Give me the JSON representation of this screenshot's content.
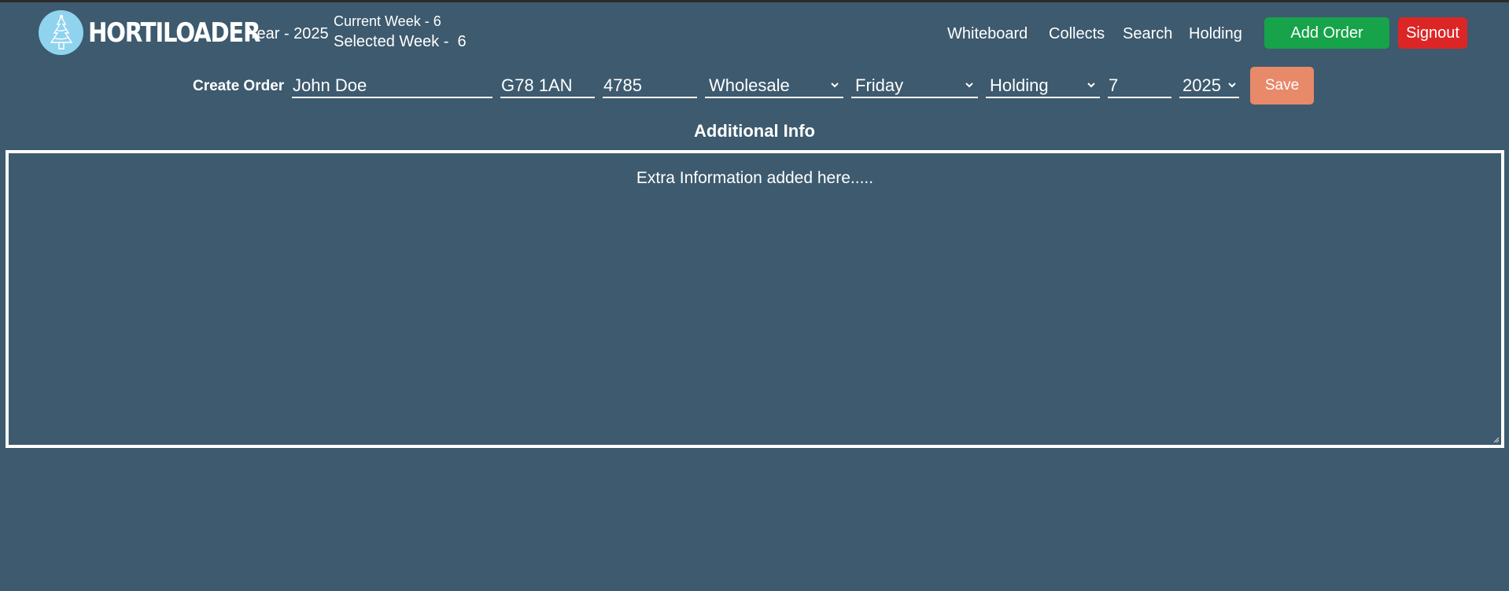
{
  "header": {
    "logo_text": "HORTILOADER",
    "year_text": "Year - 2025",
    "current_week": "Current Week - 6",
    "selected_week": "Selected Week -  6",
    "nav": {
      "whiteboard": "Whiteboard",
      "collects": "Collects",
      "search": "Search",
      "holding": "Holding"
    },
    "add_order_label": "Add Order",
    "signout_label": "Signout"
  },
  "form": {
    "label": "Create Order",
    "customer_name": "John Doe",
    "postcode": "G78 1AN",
    "number": "4785",
    "type": "Wholesale",
    "day": "Friday",
    "status": "Holding",
    "week": "7",
    "year": "2025",
    "save_label": "Save"
  },
  "additional": {
    "title": "Additional Info",
    "text": "Extra Information added here....."
  },
  "colors": {
    "background": "#3d5a6e",
    "add_order": "#16a34a",
    "signout": "#dc2626",
    "save": "#e8896a",
    "logo_circle": "#8fd3ef"
  }
}
